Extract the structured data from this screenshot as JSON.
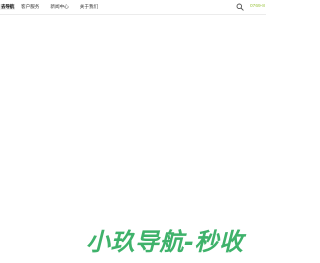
{
  "header": {
    "logo_text": "去导航",
    "nav": [
      {
        "label": "客户服务"
      },
      {
        "label": "新闻中心"
      },
      {
        "label": "关于我们"
      }
    ],
    "search_icon": "search-icon",
    "phone": "0769-8"
  },
  "banner": {
    "headline": "小玖导航-秒收"
  },
  "colors": {
    "accent": "#9bc43f",
    "headline": "#3fb26b",
    "text": "#333333",
    "background": "#ffffff"
  }
}
